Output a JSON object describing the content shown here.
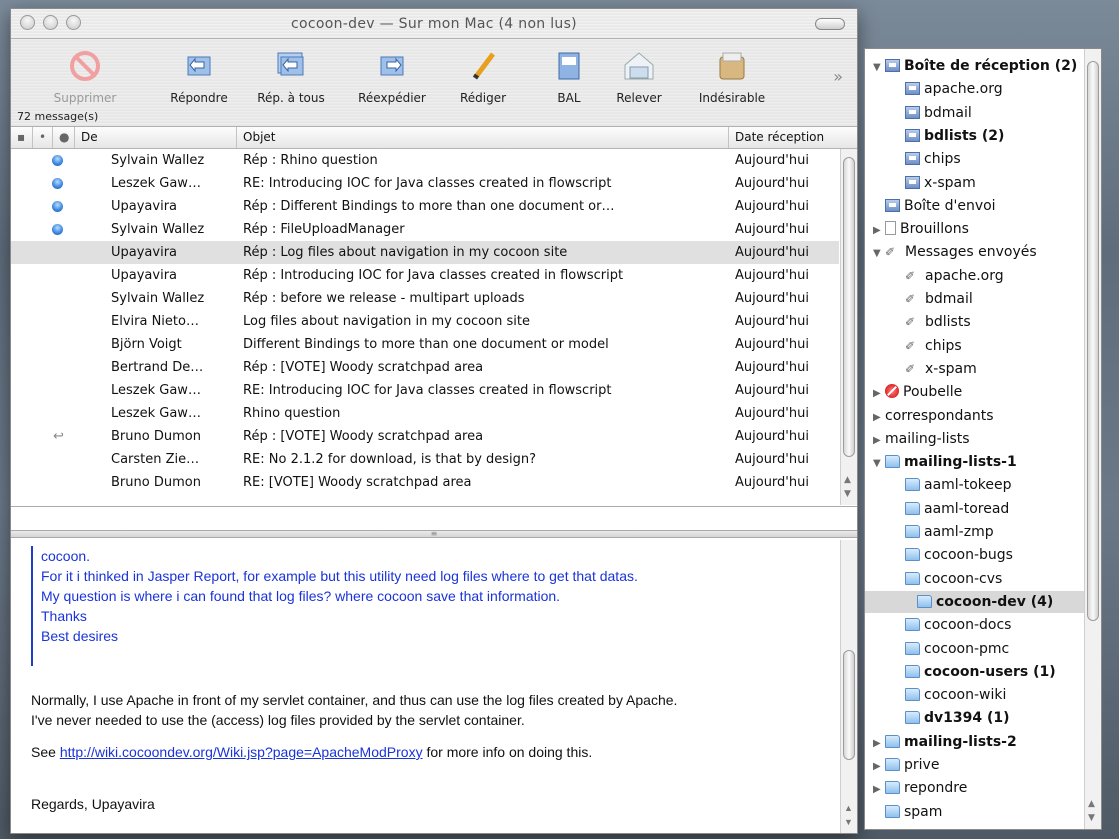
{
  "window": {
    "title": "cocoon-dev — Sur mon Mac (4 non lus)"
  },
  "toolbar": {
    "buttons": [
      {
        "label": "Supprimer",
        "icon": "delete-icon",
        "disabled": true
      },
      {
        "label": "Répondre",
        "icon": "reply-icon"
      },
      {
        "label": "Rép. à tous",
        "icon": "reply-all-icon"
      },
      {
        "label": "Réexpédier",
        "icon": "forward-icon"
      },
      {
        "label": "Rédiger",
        "icon": "compose-pencil-icon"
      },
      {
        "label": "BAL",
        "icon": "mailbox-icon"
      },
      {
        "label": "Relever",
        "icon": "get-mail-icon"
      },
      {
        "label": "Indésirable",
        "icon": "junk-icon"
      }
    ],
    "more": "»",
    "message_count": "72 message(s)"
  },
  "list": {
    "columns": [
      "De",
      "Objet",
      "Date réception"
    ],
    "rows": [
      {
        "from": "Sylvain Wallez",
        "subject": "Rép : Rhino question",
        "date": "Aujourd'hui",
        "unread": true
      },
      {
        "from": "Leszek Gaw…",
        "subject": "RE: Introducing IOC for Java classes created in flowscript",
        "date": "Aujourd'hui",
        "unread": true
      },
      {
        "from": "Upayavira",
        "subject": "Rép : Different Bindings to more than one document or…",
        "date": "Aujourd'hui",
        "unread": true
      },
      {
        "from": "Sylvain Wallez",
        "subject": "Rép : FileUploadManager",
        "date": "Aujourd'hui",
        "unread": true
      },
      {
        "from": "Upayavira",
        "subject": "Rép : Log files about navigation in my cocoon site",
        "date": "Aujourd'hui",
        "selected": true
      },
      {
        "from": "Upayavira",
        "subject": "Rép : Introducing IOC for Java classes created in flowscript",
        "date": "Aujourd'hui"
      },
      {
        "from": "Sylvain Wallez",
        "subject": "Rép : before we release - multipart uploads",
        "date": "Aujourd'hui"
      },
      {
        "from": "Elvira Nieto…",
        "subject": "Log files about navigation in my cocoon site",
        "date": "Aujourd'hui"
      },
      {
        "from": "Björn Voigt",
        "subject": "Different Bindings to more than one document or model",
        "date": "Aujourd'hui"
      },
      {
        "from": "Bertrand De…",
        "subject": "Rép : [VOTE] Woody scratchpad area",
        "date": "Aujourd'hui"
      },
      {
        "from": "Leszek Gaw…",
        "subject": "RE: Introducing IOC for Java classes created in flowscript",
        "date": "Aujourd'hui"
      },
      {
        "from": "Leszek Gaw…",
        "subject": "Rhino question",
        "date": "Aujourd'hui"
      },
      {
        "from": "Bruno Dumon",
        "subject": "Rép : [VOTE] Woody scratchpad area",
        "date": "Aujourd'hui",
        "replied": true
      },
      {
        "from": "Carsten Zie…",
        "subject": "RE: No 2.1.2 for download, is that by design?",
        "date": "Aujourd'hui"
      },
      {
        "from": "Bruno Dumon",
        "subject": "RE: [VOTE] Woody scratchpad area",
        "date": "Aujourd'hui"
      }
    ]
  },
  "preview": {
    "quote_lines": [
      "cocoon.",
      "For it i thinked in Jasper Report, for example but this utility need log files where to get that datas.",
      "My question is where i can found that log files? where cocoon save that information.",
      "Thanks",
      "Best desires"
    ],
    "p1a": "Normally, I use Apache in front of my servlet container, and thus can use the log files created by Apache.",
    "p1b": "I've never needed to use the (access) log files provided by the servlet container.",
    "see": "See ",
    "link": "http://wiki.cocoondev.org/Wiki.jsp?page=ApacheModProxy",
    "see_after": " for more info on doing this.",
    "regards": "Regards, Upayavira"
  },
  "drawer": {
    "items": [
      {
        "label": "Boîte de réception (2)",
        "bold": true,
        "tri": "▼",
        "icon": "inbox"
      },
      {
        "label": "apache.org",
        "indent": 1,
        "icon": "inbox"
      },
      {
        "label": "bdmail",
        "indent": 1,
        "icon": "inbox"
      },
      {
        "label": "bdlists (2)",
        "indent": 1,
        "bold": true,
        "icon": "inbox"
      },
      {
        "label": "chips",
        "indent": 1,
        "icon": "inbox"
      },
      {
        "label": "x-spam",
        "indent": 1,
        "icon": "inbox"
      },
      {
        "label": "Boîte d'envoi",
        "icon": "inbox"
      },
      {
        "label": "Brouillons",
        "tri": "▶",
        "icon": "doc"
      },
      {
        "label": "Messages envoyés",
        "tri": "▼",
        "icon": "sent"
      },
      {
        "label": "apache.org",
        "indent": 1,
        "icon": "sent"
      },
      {
        "label": "bdmail",
        "indent": 1,
        "icon": "sent"
      },
      {
        "label": "bdlists",
        "indent": 1,
        "icon": "sent"
      },
      {
        "label": "chips",
        "indent": 1,
        "icon": "sent"
      },
      {
        "label": "x-spam",
        "indent": 1,
        "icon": "sent"
      },
      {
        "label": "Poubelle",
        "tri": "▶",
        "icon": "trash"
      },
      {
        "label": "correspondants",
        "tri": "▶",
        "icon": ""
      },
      {
        "label": "mailing-lists",
        "tri": "▶",
        "icon": ""
      },
      {
        "label": "mailing-lists-1",
        "tri": "▼",
        "bold": true,
        "icon": "folder"
      },
      {
        "label": "aaml-tokeep",
        "indent": 1,
        "icon": "folder"
      },
      {
        "label": "aaml-toread",
        "indent": 1,
        "icon": "folder"
      },
      {
        "label": "aaml-zmp",
        "indent": 1,
        "icon": "folder"
      },
      {
        "label": "cocoon-bugs",
        "indent": 1,
        "icon": "folder"
      },
      {
        "label": "cocoon-cvs",
        "indent": 1,
        "icon": "folder"
      },
      {
        "label": "cocoon-dev (4)",
        "indent": 1,
        "bold": true,
        "selected": true,
        "icon": "folder"
      },
      {
        "label": "cocoon-docs",
        "indent": 1,
        "icon": "folder"
      },
      {
        "label": "cocoon-pmc",
        "indent": 1,
        "icon": "folder"
      },
      {
        "label": "cocoon-users (1)",
        "indent": 1,
        "bold": true,
        "icon": "folder"
      },
      {
        "label": "cocoon-wiki",
        "indent": 1,
        "icon": "folder"
      },
      {
        "label": "dv1394 (1)",
        "indent": 1,
        "bold": true,
        "icon": "folder"
      },
      {
        "label": "mailing-lists-2",
        "tri": "▶",
        "bold": true,
        "icon": "folder"
      },
      {
        "label": "prive",
        "tri": "▶",
        "icon": "folder"
      },
      {
        "label": "repondre",
        "tri": "▶",
        "icon": "folder"
      },
      {
        "label": "spam",
        "icon": "folder"
      }
    ]
  }
}
